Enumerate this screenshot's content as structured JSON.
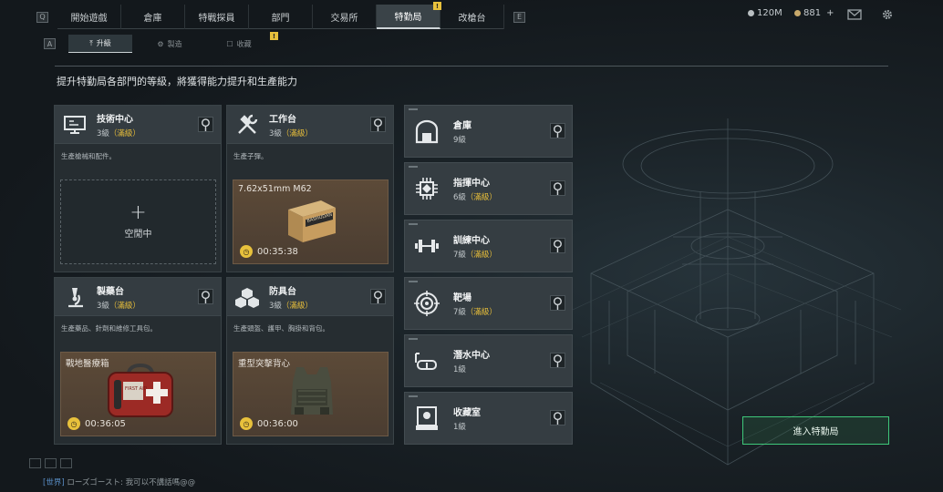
{
  "nav": {
    "left_key": "Q",
    "right_key": "E",
    "tabs": [
      {
        "label": "開始遊戲",
        "active": false
      },
      {
        "label": "倉庫",
        "active": false
      },
      {
        "label": "特戰探員",
        "active": false
      },
      {
        "label": "部門",
        "active": false
      },
      {
        "label": "交易所",
        "active": false
      },
      {
        "label": "特勤局",
        "active": true,
        "badge": "!"
      },
      {
        "label": "改槍台",
        "active": false
      }
    ]
  },
  "resources": {
    "silver": "120M",
    "gold": "881",
    "add": "+"
  },
  "subnav": {
    "left_key": "A",
    "tabs": [
      {
        "label": "升級",
        "active": true
      },
      {
        "label": "製造",
        "active": false
      },
      {
        "label": "收藏",
        "active": false,
        "badge": "!"
      }
    ]
  },
  "description": "提升特勤局各部門的等級，將獲得能力提升和生產能力",
  "big_cards": [
    {
      "name": "技術中心",
      "level": "3級",
      "maxed": "（滿級）",
      "desc": "生產槍械和配件。",
      "status": "空閒中"
    },
    {
      "name": "工作台",
      "level": "3級",
      "maxed": "（滿級）",
      "desc": "生產子彈。",
      "item": "7.62x51mm M62",
      "timer": "00:35:38"
    },
    {
      "name": "製藥台",
      "level": "3級",
      "maxed": "（滿級）",
      "desc": "生產藥品、針劑和維修工具包。",
      "item": "戰地醫療箱",
      "timer": "00:36:05"
    },
    {
      "name": "防具台",
      "level": "3級",
      "maxed": "（滿級）",
      "desc": "生產頭盔、護甲、胸掛和背包。",
      "item": "重型突擊背心",
      "timer": "00:36:00"
    }
  ],
  "small_cards": [
    {
      "name": "倉庫",
      "level": "9級",
      "maxed": ""
    },
    {
      "name": "指揮中心",
      "level": "6級",
      "maxed": "（滿級）"
    },
    {
      "name": "訓練中心",
      "level": "7級",
      "maxed": "（滿級）"
    },
    {
      "name": "靶場",
      "level": "7級",
      "maxed": "（滿級）"
    },
    {
      "name": "潛水中心",
      "level": "1級",
      "maxed": ""
    },
    {
      "name": "收藏室",
      "level": "1級",
      "maxed": ""
    }
  ],
  "enter_button": "進入特勤局",
  "chat": {
    "channel": "[世界]",
    "user": "ローズゴースト:",
    "message": "我可以不講話嗎@@"
  },
  "ammo_box_text": "BASHUDAN",
  "medkit_text": "FIRST AID",
  "colors": {
    "accent": "#e6bd3a",
    "enter_border": "#3ec87a",
    "active_tab": "#3a4348"
  }
}
